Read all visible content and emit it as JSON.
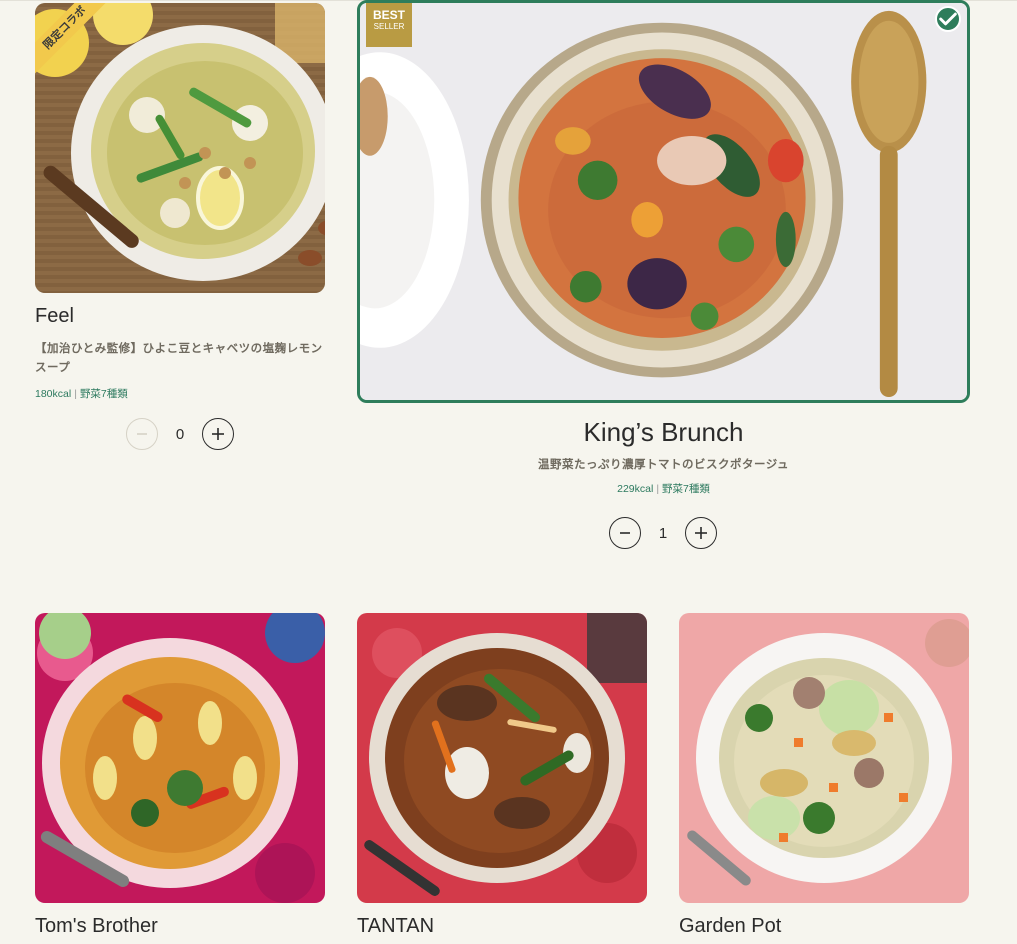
{
  "products": {
    "feel": {
      "name": "Feel",
      "badge": "限定コラボ",
      "description": "【加治ひとみ監修】ひよこ豆とキャベツの塩麹レモンスープ",
      "kcal": "180kcal",
      "veg": "野菜7種類",
      "quantity": "0"
    },
    "kings_brunch": {
      "name": "King’s Brunch",
      "badge_main": "BEST",
      "badge_sub": "SELLER",
      "description": "温野菜たっぷり濃厚トマトのビスクポタージュ",
      "kcal": "229kcal",
      "veg": "野菜7種類",
      "quantity": "1"
    },
    "toms_brother": {
      "name": "Tom's Brother"
    },
    "tantan": {
      "name": "TANTAN"
    },
    "garden_pot": {
      "name": "Garden Pot"
    }
  },
  "separator": "|",
  "colors": {
    "accent": "#2e7d5b",
    "background": "#f6f5ee",
    "badge_gold": "#b99b43",
    "collab_yellow": "#f2c94c"
  },
  "icons": [
    "minus-icon",
    "plus-icon",
    "check-icon"
  ]
}
